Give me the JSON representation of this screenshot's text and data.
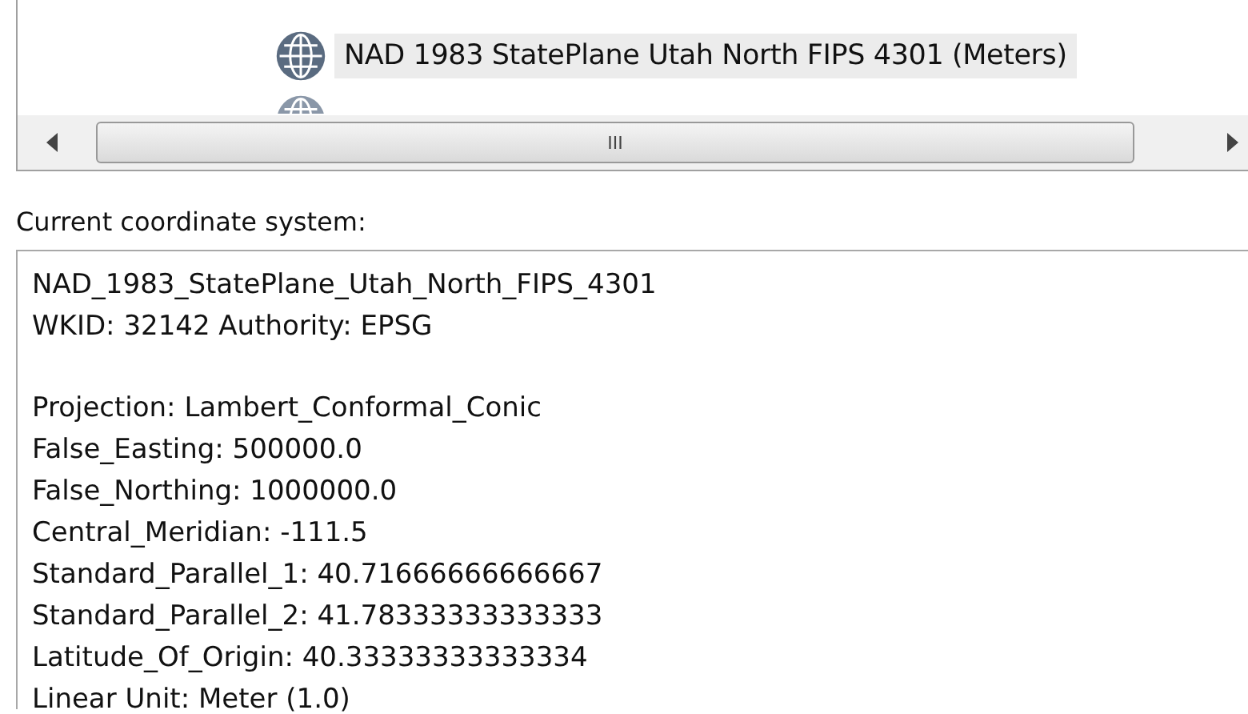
{
  "coordinate_list": {
    "items": [
      {
        "label": "NAD 1983 StatePlane Utah North FIPS 4301 (Meters)",
        "selected": true
      }
    ],
    "scrollbar": {
      "thumb_label": "III"
    }
  },
  "current_label": "Current coordinate system:",
  "details": {
    "header": [
      "NAD_1983_StatePlane_Utah_North_FIPS_4301",
      "WKID: 32142 Authority: EPSG"
    ],
    "properties": [
      "Projection: Lambert_Conformal_Conic",
      "False_Easting: 500000.0",
      "False_Northing: 1000000.0",
      "Central_Meridian: -111.5",
      "Standard_Parallel_1: 40.71666666666667",
      "Standard_Parallel_2: 41.78333333333333",
      "Latitude_Of_Origin: 40.33333333333334",
      "Linear Unit: Meter (1.0)"
    ]
  }
}
